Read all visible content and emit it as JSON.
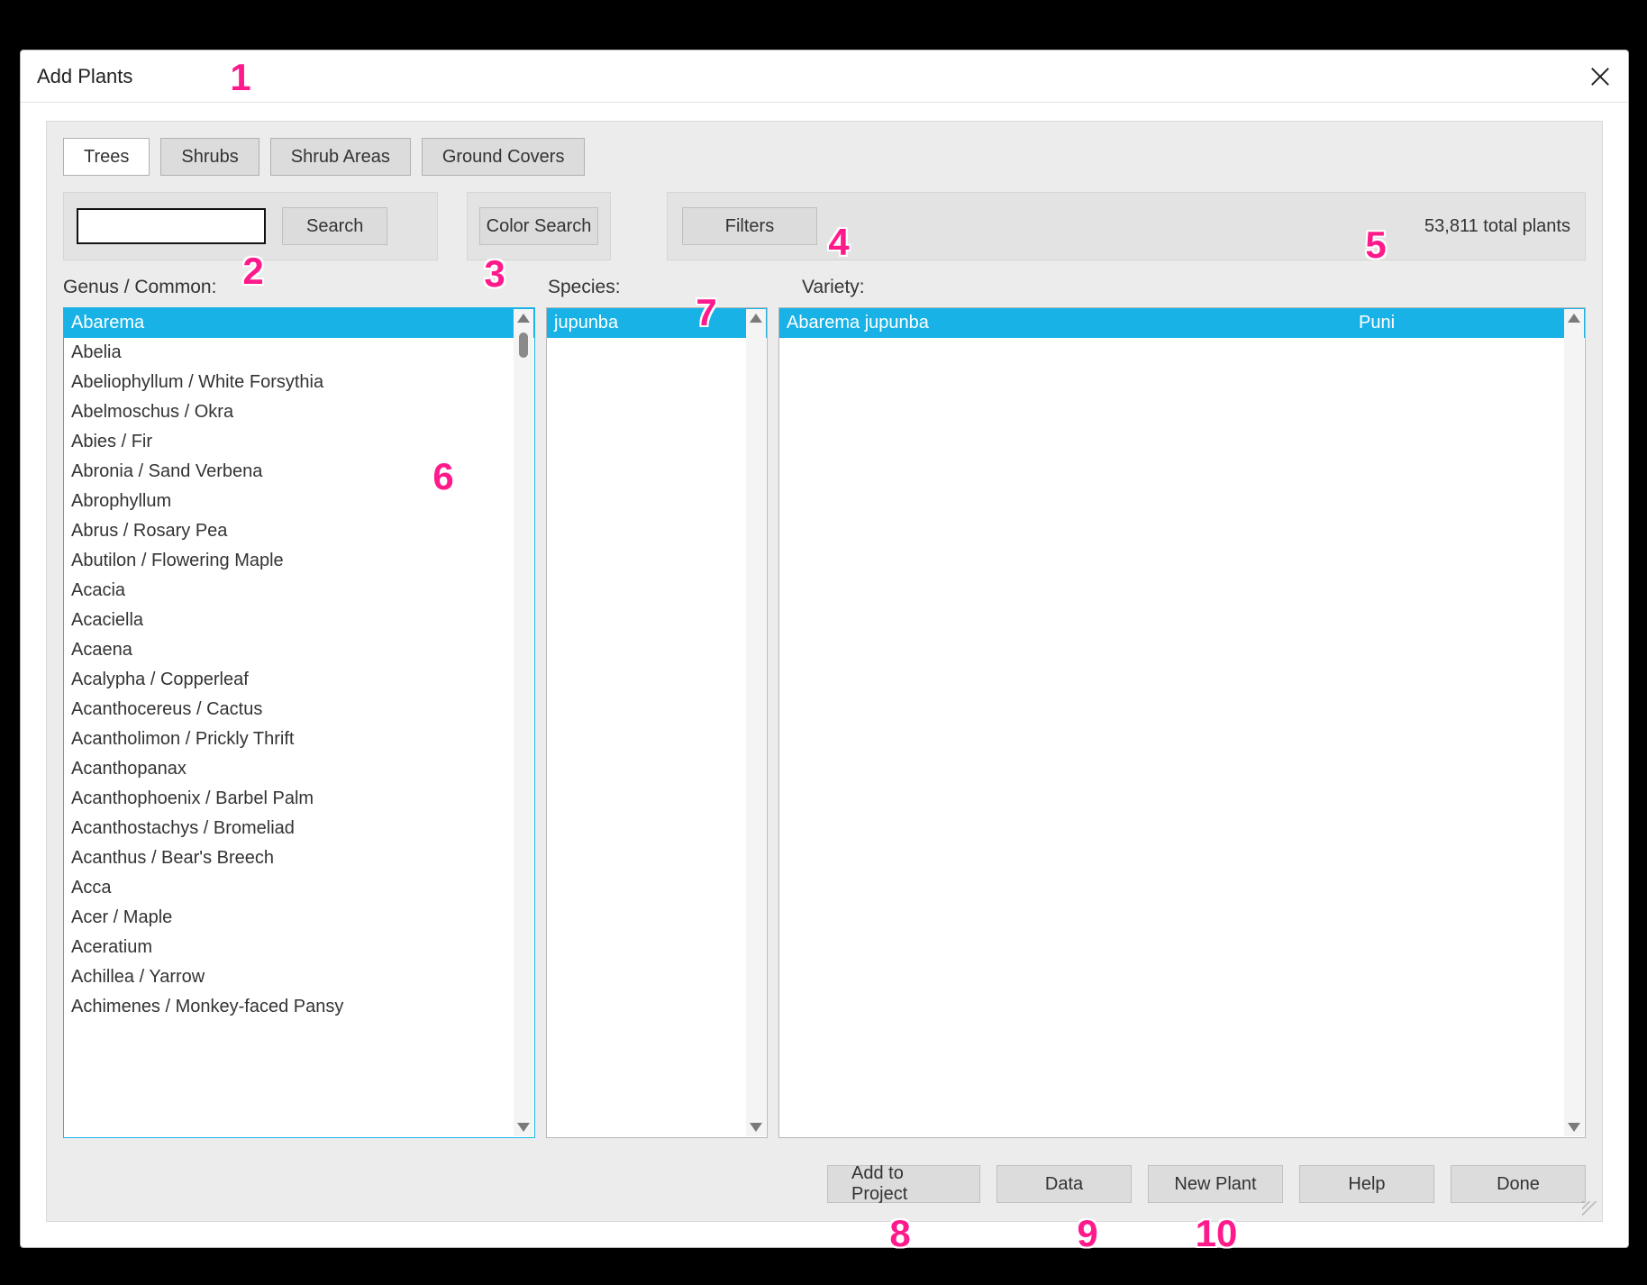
{
  "window": {
    "title": "Add Plants"
  },
  "tabs": {
    "items": [
      {
        "label": "Trees",
        "active": true
      },
      {
        "label": "Shrubs",
        "active": false
      },
      {
        "label": "Shrub Areas",
        "active": false
      },
      {
        "label": "Ground Covers",
        "active": false
      }
    ]
  },
  "search": {
    "value": "",
    "placeholder": "",
    "button": "Search"
  },
  "color_search": {
    "button": "Color Search"
  },
  "filters": {
    "button": "Filters"
  },
  "total_plants": "53,811 total plants",
  "columns": {
    "genus": "Genus / Common:",
    "species": "Species:",
    "variety": "Variety:"
  },
  "genus_list": [
    "Abarema",
    "Abelia",
    "Abeliophyllum / White Forsythia",
    "Abelmoschus / Okra",
    "Abies / Fir",
    "Abronia / Sand Verbena",
    "Abrophyllum",
    "Abrus / Rosary Pea",
    "Abutilon / Flowering Maple",
    "Acacia",
    "Acaciella",
    "Acaena",
    "Acalypha / Copperleaf",
    "Acanthocereus / Cactus",
    "Acantholimon / Prickly Thrift",
    "Acanthopanax",
    "Acanthophoenix / Barbel Palm",
    "Acanthostachys / Bromeliad",
    "Acanthus / Bear's Breech",
    "Acca",
    "Acer / Maple",
    "Aceratium",
    "Achillea / Yarrow",
    "Achimenes / Monkey-faced Pansy"
  ],
  "genus_selected_index": 0,
  "species_list": [
    "jupunba"
  ],
  "species_selected_index": 0,
  "variety_list": [
    {
      "name": "Abarema jupunba",
      "variety": "Puni"
    }
  ],
  "variety_selected_index": 0,
  "buttons": {
    "add_to_project": "Add to Project",
    "data": "Data",
    "new_plant": "New Plant",
    "help": "Help",
    "done": "Done"
  },
  "callouts": {
    "1": "1",
    "2": "2",
    "3": "3",
    "4": "4",
    "5": "5",
    "6": "6",
    "7": "7",
    "8": "8",
    "9": "9",
    "10": "10"
  }
}
